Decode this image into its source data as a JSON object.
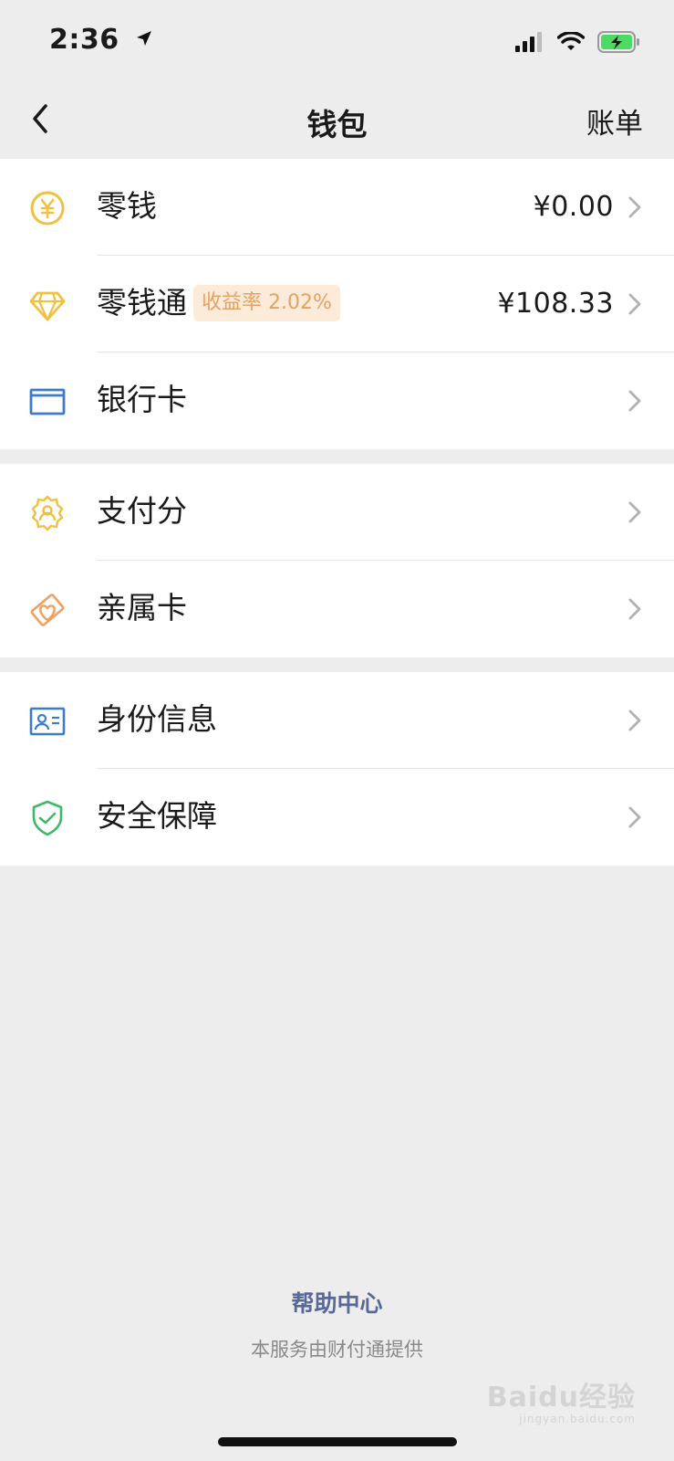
{
  "status_bar": {
    "time": "2:36",
    "icons": [
      "location-arrow-icon",
      "cellular-signal-icon",
      "wifi-icon",
      "battery-charging-icon"
    ]
  },
  "nav": {
    "title": "钱包",
    "right_label": "账单",
    "back_icon": "chevron-left-icon"
  },
  "groups": [
    {
      "items": [
        {
          "label": "零钱",
          "value": "¥0.00",
          "icon": "yuan-coin-icon",
          "icon_color": "#f0c040"
        },
        {
          "label": "零钱通",
          "badge": "收益率 2.02%",
          "value": "¥108.33",
          "icon": "diamond-icon",
          "icon_color": "#f0c040"
        },
        {
          "label": "银行卡",
          "icon": "bank-card-icon",
          "icon_color": "#3f7cc7"
        }
      ]
    },
    {
      "items": [
        {
          "label": "支付分",
          "icon": "badge-person-icon",
          "icon_color": "#f0c040"
        },
        {
          "label": "亲属卡",
          "icon": "family-card-icon",
          "icon_color": "#f0a060"
        }
      ]
    },
    {
      "items": [
        {
          "label": "身份信息",
          "icon": "id-card-icon",
          "icon_color": "#3f7cc7"
        },
        {
          "label": "安全保障",
          "icon": "shield-check-icon",
          "icon_color": "#3fb868"
        }
      ]
    }
  ],
  "footer": {
    "help_center": "帮助中心",
    "provider_note": "本服务由财付通提供"
  },
  "watermark": {
    "text": "Baidu经验",
    "sub": "jingyan.baidu.com"
  },
  "colors": {
    "background": "#ededed",
    "link": "#56699a",
    "badge_bg": "#fdebd9",
    "badge_text": "#e2a366"
  }
}
